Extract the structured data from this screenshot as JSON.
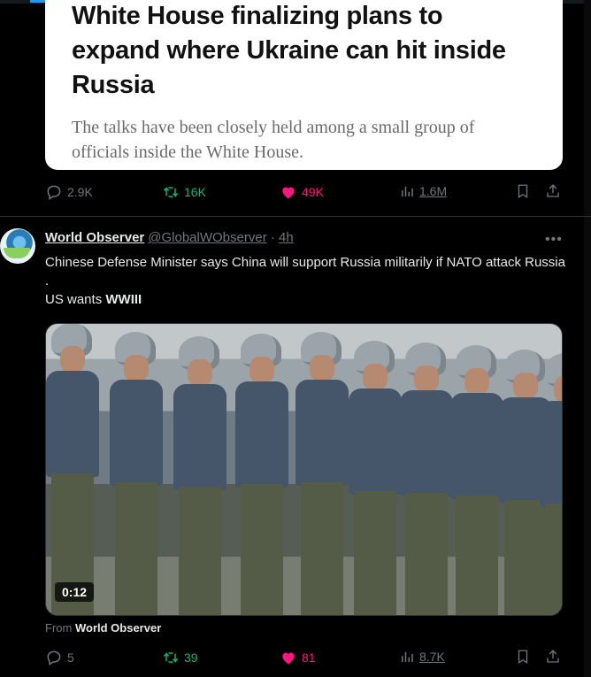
{
  "article": {
    "title": "White House finalizing plans to expand where Ukraine can hit inside Russia",
    "subtitle": "The talks have been closely held among a small group of officials inside the White House."
  },
  "first_actions": {
    "replies": "2.9K",
    "reposts": "16K",
    "likes": "49K",
    "views": "1.6M",
    "colors": {
      "repost": "#00ba7c",
      "like": "#f91880"
    }
  },
  "post": {
    "author_name": "World Observer",
    "author_handle": "@GlobalWObserver",
    "separator": "·",
    "time": "4h",
    "text_line1": "Chinese Defense Minister says China will support Russia militarily if NATO attack Russia .",
    "text_line2_prefix": "US wants",
    "text_line2_bold": "WWIII",
    "video_duration": "0:12",
    "from_prefix": "From",
    "from_name": "World Observer"
  },
  "second_actions": {
    "replies": "5",
    "reposts": "39",
    "likes": "81",
    "views": "8.7K"
  },
  "icons": [
    "reply-icon",
    "repost-icon",
    "like-icon",
    "views-icon",
    "bookmark-icon",
    "share-icon",
    "more-icon",
    "avatar"
  ]
}
